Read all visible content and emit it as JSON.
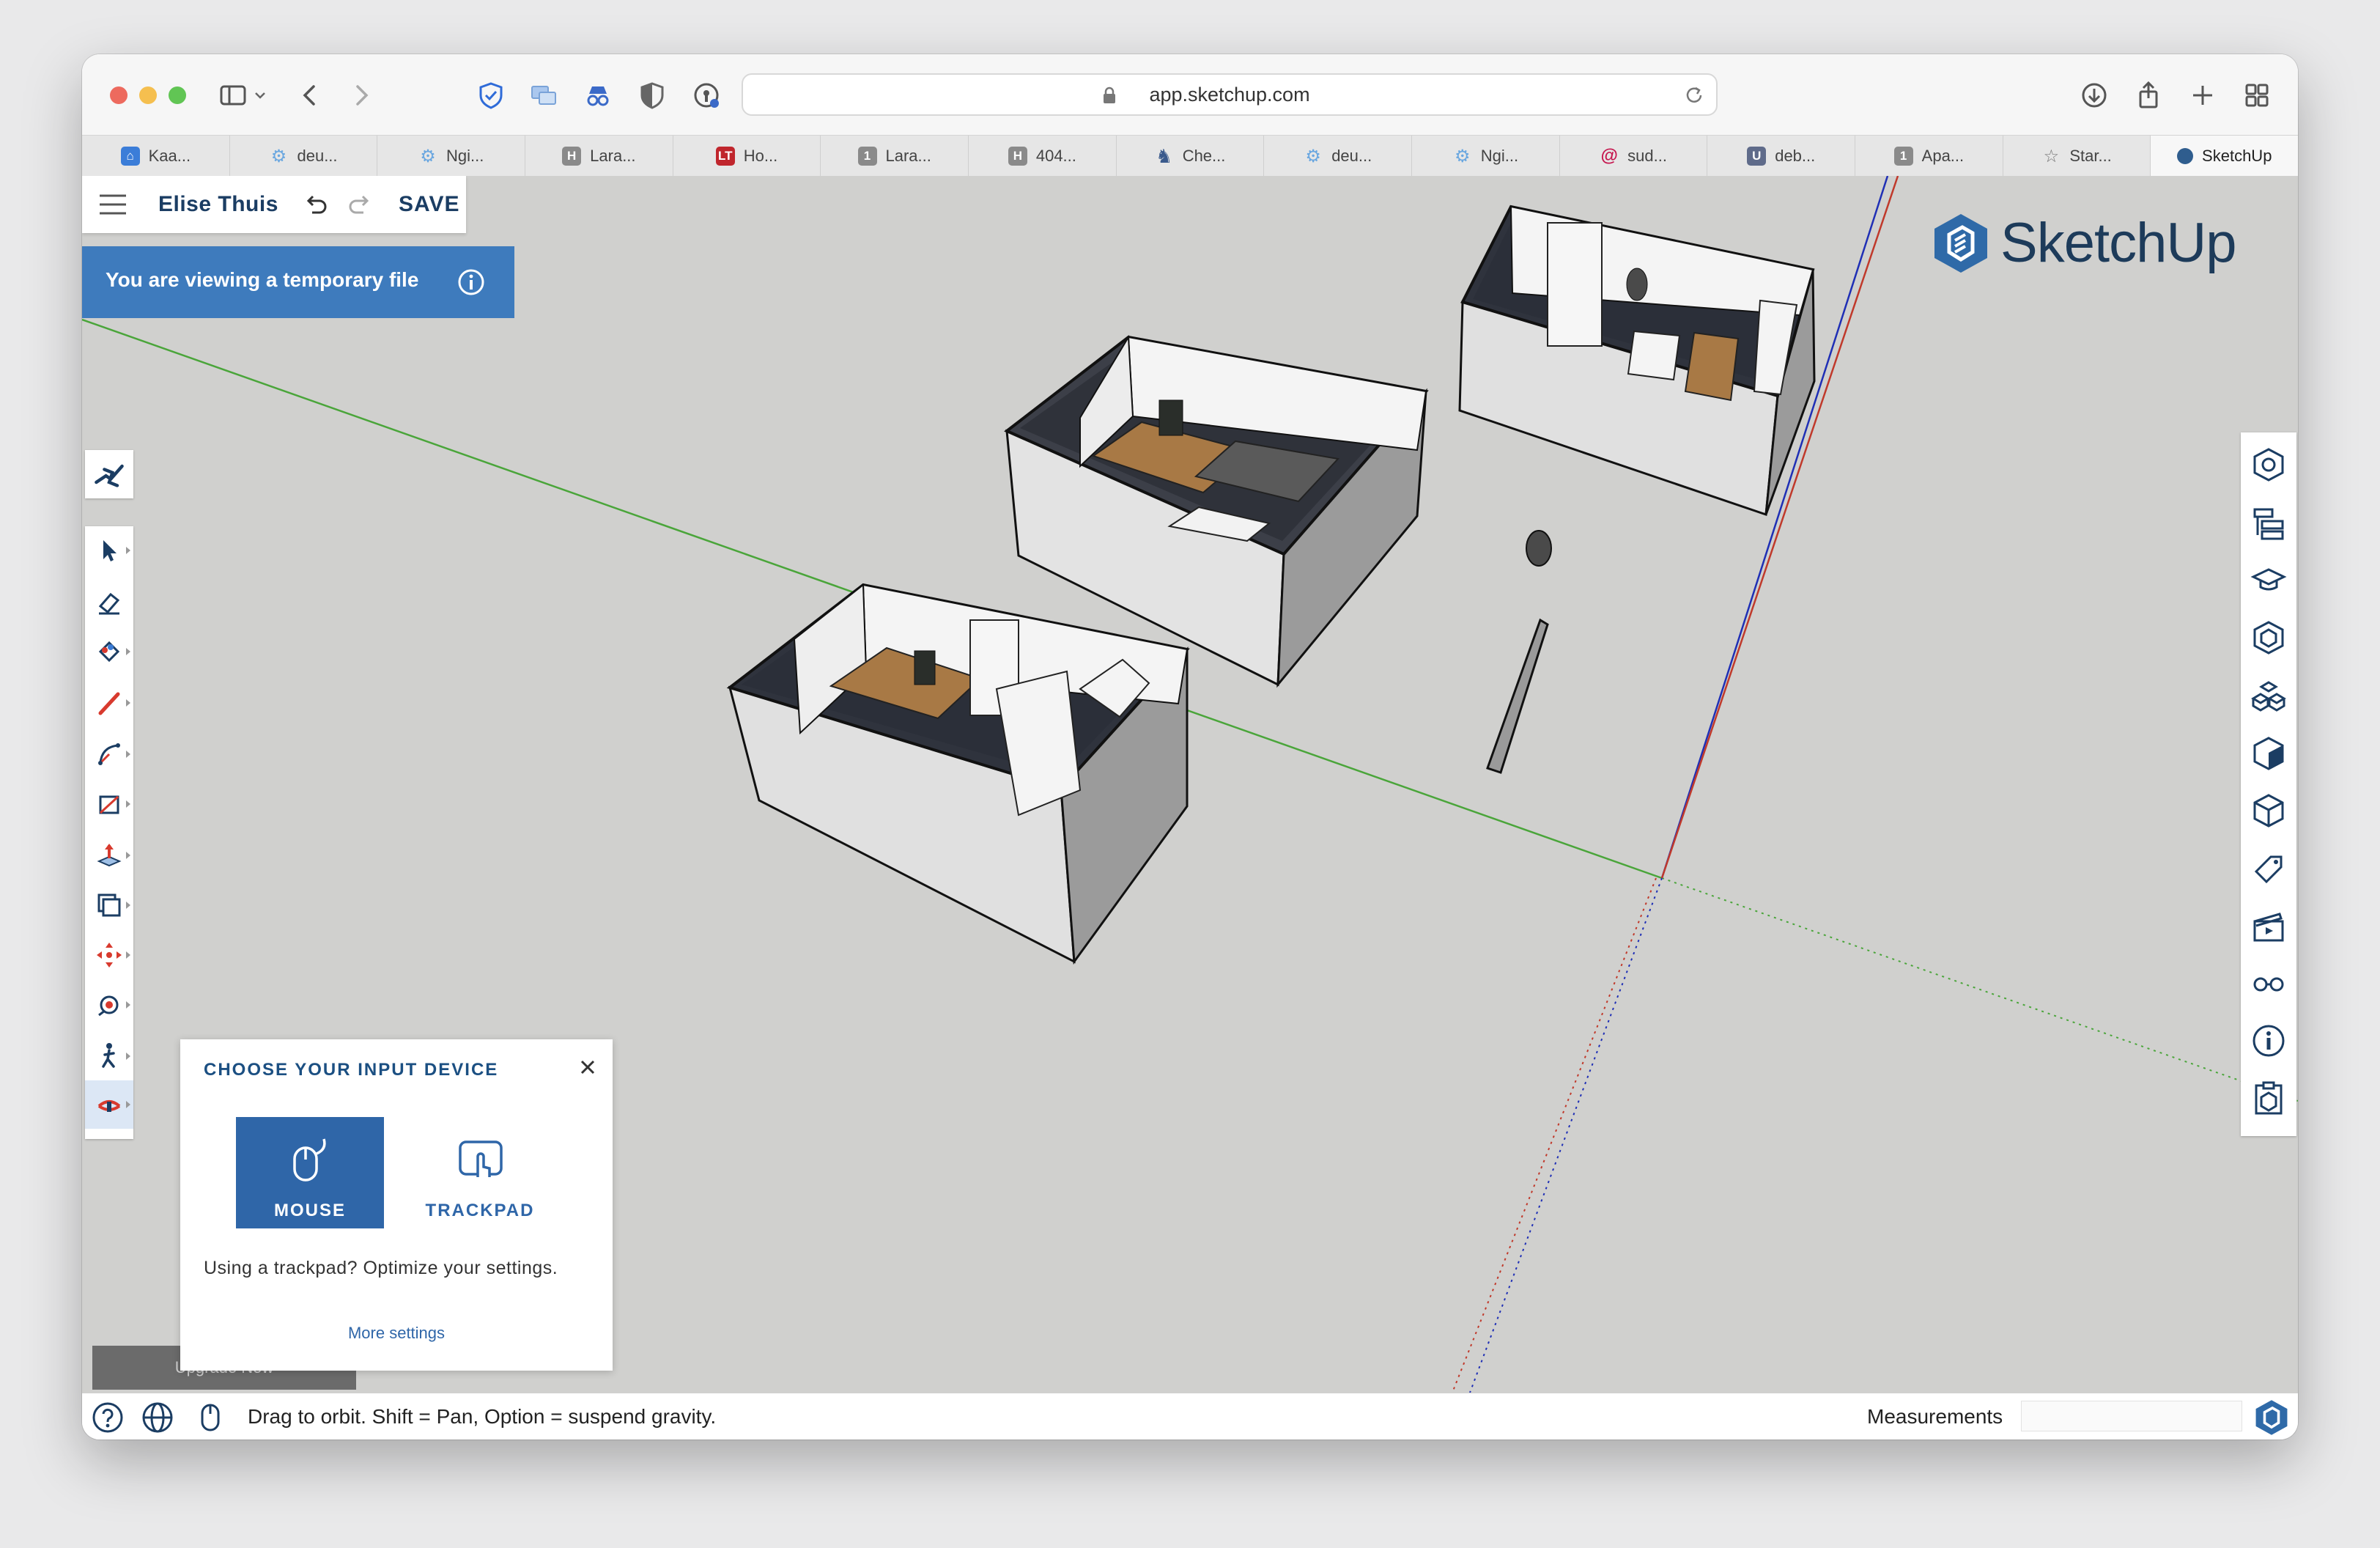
{
  "browser": {
    "url": "app.sketchup.com",
    "tabs": [
      {
        "label": "Kaa...",
        "icon": "kaa-house-icon",
        "color": "#3b7dd8"
      },
      {
        "label": "deu...",
        "icon": "gear-icon",
        "color": "#6aa7e0"
      },
      {
        "label": "Ngi...",
        "icon": "gear-icon",
        "color": "#6aa7e0"
      },
      {
        "label": "Lara...",
        "icon": "h-icon",
        "glyph": "H",
        "color": "#8a8a8a"
      },
      {
        "label": "Ho...",
        "icon": "lt-icon",
        "glyph": "LT",
        "color": "#c0262d"
      },
      {
        "label": "Lara...",
        "icon": "one-icon",
        "glyph": "1",
        "color": "#8a8a8a"
      },
      {
        "label": "404...",
        "icon": "h-icon",
        "glyph": "H",
        "color": "#8a8a8a"
      },
      {
        "label": "Che...",
        "icon": "knight-icon",
        "color": "#3a5a8c"
      },
      {
        "label": "deu...",
        "icon": "gear-icon",
        "color": "#6aa7e0"
      },
      {
        "label": "Ngi...",
        "icon": "gear-icon",
        "color": "#6aa7e0"
      },
      {
        "label": "sud...",
        "icon": "debian-swirl-icon",
        "color": "#c6174f"
      },
      {
        "label": "deb...",
        "icon": "ul-icon",
        "glyph": "U",
        "color": "#5f6b8a"
      },
      {
        "label": "Apa...",
        "icon": "one-icon",
        "glyph": "1",
        "color": "#8a8a8a"
      },
      {
        "label": "Star...",
        "icon": "star-icon",
        "color": "#777777"
      },
      {
        "label": "SketchUp",
        "icon": "sketchup-icon",
        "color": "#2f5d8e",
        "active": true
      }
    ]
  },
  "app": {
    "user": "Elise Thuis",
    "save_label": "SAVE",
    "banner_text": "You are viewing a temporary file",
    "logo_text": "SketchUp",
    "upgrade_label": "Upgrade Now"
  },
  "dialog": {
    "title": "CHOOSE YOUR INPUT DEVICE",
    "mouse_label": "MOUSE",
    "trackpad_label": "TRACKPAD",
    "hint": "Using a trackpad? Optimize your settings.",
    "link": "More settings"
  },
  "status": {
    "hint": "Drag to orbit. Shift = Pan, Option = suspend gravity.",
    "measurements_label": "Measurements",
    "measurements_value": ""
  },
  "colors": {
    "brand": "#1d3b5a",
    "accent": "#3e7bbd",
    "button_blue": "#2f66a8",
    "viewport": "#d0d0ce",
    "axis_green": "#4aa53a",
    "axis_red": "#c0392b",
    "axis_blue": "#1f2fb5"
  }
}
